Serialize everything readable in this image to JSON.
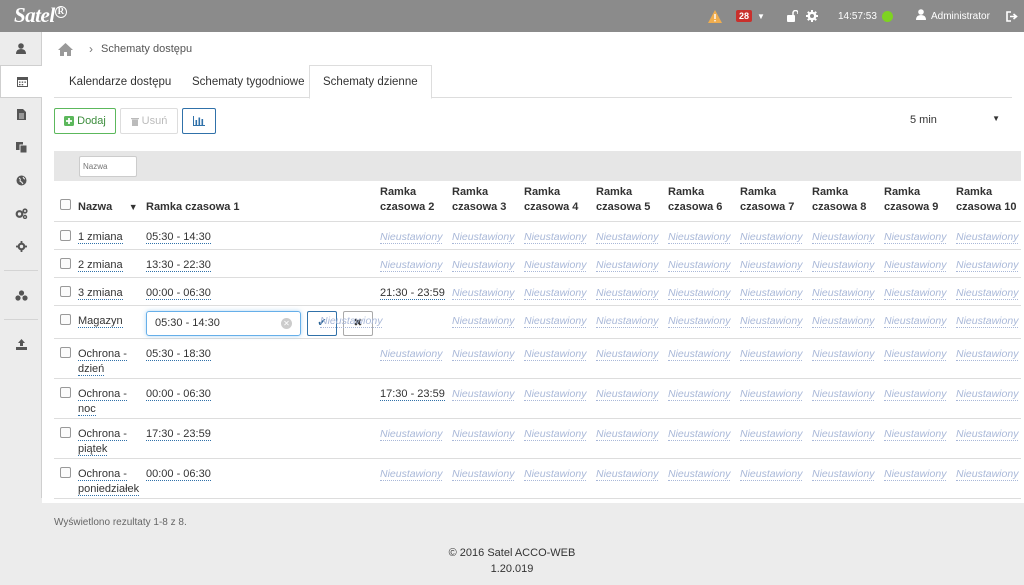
{
  "topbar": {
    "brand": "Satel",
    "brand_mark": "R",
    "alarm_count": "28",
    "time": "14:57:53",
    "user": "Administrator"
  },
  "breadcrumb": {
    "current": "Schematy dostępu"
  },
  "tabs": [
    {
      "label": "Kalendarze dostępu"
    },
    {
      "label": "Schematy tygodniowe"
    },
    {
      "label": "Schematy dzienne"
    }
  ],
  "toolbar": {
    "add_label": "Dodaj",
    "delete_label": "Usuń",
    "interval": "5 min"
  },
  "filter": {
    "name_placeholder": "Nazwa"
  },
  "table": {
    "headers": [
      "Nazwa",
      "Ramka czasowa 1",
      "Ramka czasowa 2",
      "Ramka czasowa 3",
      "Ramka czasowa 4",
      "Ramka czasowa 5",
      "Ramka czasowa 6",
      "Ramka czasowa 7",
      "Ramka czasowa 8",
      "Ramka czasowa 9",
      "Ramka czasowa 10"
    ],
    "unset_label": "Nieustawiony",
    "rows": [
      {
        "name": "1 zmiana",
        "frames": [
          "05:30 - 14:30",
          "",
          "",
          "",
          "",
          "",
          "",
          "",
          "",
          ""
        ]
      },
      {
        "name": "2 zmiana",
        "frames": [
          "13:30 - 22:30",
          "",
          "",
          "",
          "",
          "",
          "",
          "",
          "",
          ""
        ]
      },
      {
        "name": "3 zmiana",
        "frames": [
          "00:00 - 06:30",
          "21:30 - 23:59",
          "",
          "",
          "",
          "",
          "",
          "",
          "",
          ""
        ]
      },
      {
        "name": "Magazyn",
        "frames": [
          "05:30 - 14:30",
          "",
          "",
          "",
          "",
          "",
          "",
          "",
          "",
          ""
        ],
        "editing": true
      },
      {
        "name": "Ochrona - dzień",
        "frames": [
          "05:30 - 18:30",
          "",
          "",
          "",
          "",
          "",
          "",
          "",
          "",
          ""
        ]
      },
      {
        "name": "Ochrona - noc",
        "frames": [
          "00:00 - 06:30",
          "17:30 - 23:59",
          "",
          "",
          "",
          "",
          "",
          "",
          "",
          ""
        ]
      },
      {
        "name": "Ochrona - piątek",
        "frames": [
          "17:30 - 23:59",
          "",
          "",
          "",
          "",
          "",
          "",
          "",
          "",
          ""
        ]
      },
      {
        "name": "Ochrona - poniedziałek",
        "frames": [
          "00:00 - 06:30",
          "",
          "",
          "",
          "",
          "",
          "",
          "",
          "",
          ""
        ]
      }
    ]
  },
  "result_info": "Wyświetlono rezultaty 1-8 z 8.",
  "footer": {
    "copyright": "© 2016 Satel ACCO-WEB",
    "version": "1.20.019"
  },
  "colors": {
    "topbar": "#8b8b8b",
    "add_green": "#5cb85c",
    "link_blue": "#3071a9",
    "status_green": "#7ed321",
    "alarm_red": "#c9302c"
  }
}
